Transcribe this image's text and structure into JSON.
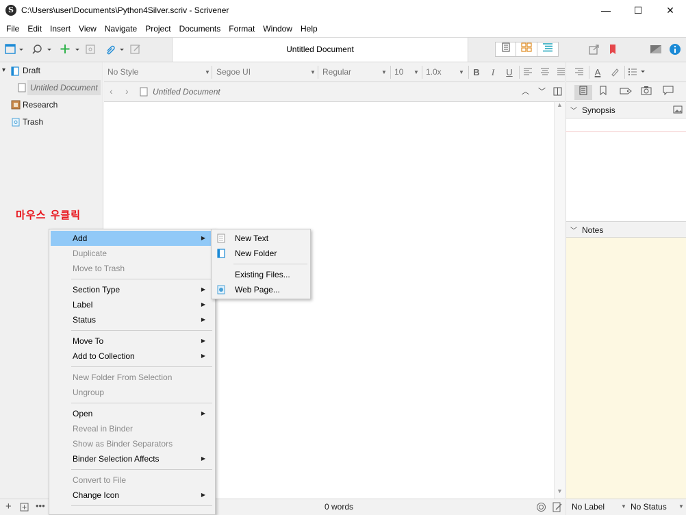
{
  "window": {
    "title": "C:\\Users\\user\\Documents\\Python4Silver.scriv - Scrivener",
    "app_icon": "S",
    "controls": {
      "minimize": "—",
      "maximize": "☐",
      "close": "✕"
    }
  },
  "menubar": [
    "File",
    "Edit",
    "Insert",
    "View",
    "Navigate",
    "Project",
    "Documents",
    "Format",
    "Window",
    "Help"
  ],
  "toolbar": {
    "document_title": "Untitled Document"
  },
  "binder": {
    "items": [
      {
        "label": "Draft",
        "icon": "draft-icon",
        "expanded": true
      },
      {
        "label": "Untitled Document",
        "icon": "document-icon",
        "selected": true
      },
      {
        "label": "Research",
        "icon": "research-icon"
      },
      {
        "label": "Trash",
        "icon": "trash-icon"
      }
    ],
    "expand_glyph": "▾"
  },
  "formatbar": {
    "style": "No Style",
    "font": "Segoe UI",
    "weight": "Regular",
    "size": "10",
    "spacing": "1.0x",
    "bold": "B",
    "italic": "I",
    "underline": "U",
    "text_color": "A"
  },
  "editor": {
    "header_title": "Untitled Document",
    "word_count": "0 words"
  },
  "inspector": {
    "synopsis_title": "Synopsis",
    "notes_title": "Notes",
    "label_value": "No Label",
    "status_value": "No Status"
  },
  "annotation": "마우스 우클릭",
  "context_menu": {
    "items": [
      {
        "label": "Add",
        "submenu": true,
        "active": true
      },
      {
        "label": "Duplicate",
        "disabled": true
      },
      {
        "label": "Move to Trash",
        "disabled": true
      },
      {
        "label": "Section Type",
        "submenu": true
      },
      {
        "label": "Label",
        "submenu": true
      },
      {
        "label": "Status",
        "submenu": true
      },
      {
        "label": "Move To",
        "submenu": true
      },
      {
        "label": "Add to Collection",
        "submenu": true
      },
      {
        "label": "New Folder From Selection",
        "disabled": true
      },
      {
        "label": "Ungroup",
        "disabled": true
      },
      {
        "label": "Open",
        "submenu": true
      },
      {
        "label": "Reveal in Binder",
        "disabled": true
      },
      {
        "label": "Show as Binder Separators",
        "disabled": true
      },
      {
        "label": "Binder Selection Affects",
        "submenu": true
      },
      {
        "label": "Convert to File",
        "disabled": true
      },
      {
        "label": "Change Icon",
        "submenu": true
      }
    ],
    "arrow_glyph": "▶"
  },
  "submenu": {
    "items": [
      {
        "label": "New Text",
        "icon": "text-doc-icon"
      },
      {
        "label": "New Folder",
        "icon": "folder-icon"
      },
      {
        "label": "Existing Files...",
        "icon": ""
      },
      {
        "label": "Web Page...",
        "icon": "web-page-icon"
      }
    ]
  },
  "colors": {
    "accent": "#1b8ad6",
    "menu_highlight": "#91c9f7",
    "annotation_red": "#e8141b",
    "notes_bg": "#fdf8e2",
    "add_green": "#2fb24a",
    "bookmark_red": "#e5474b"
  }
}
